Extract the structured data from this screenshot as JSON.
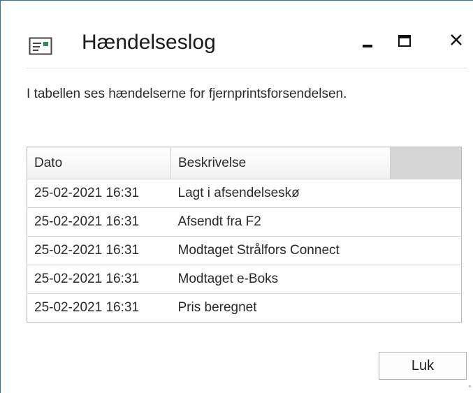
{
  "window": {
    "title": "Hændelseslog",
    "controls": {
      "minimize": "minimize-icon",
      "maximize": "maximize-icon",
      "close": "close-icon"
    }
  },
  "description": "I tabellen ses hændelserne for fjernprintsforsendelsen.",
  "table": {
    "columns": [
      "Dato",
      "Beskrivelse"
    ],
    "rows": [
      {
        "date": "25-02-2021 16:31",
        "description": "Lagt i afsendelseskø"
      },
      {
        "date": "25-02-2021 16:31",
        "description": "Afsendt fra F2"
      },
      {
        "date": "25-02-2021 16:31",
        "description": "Modtaget Strålfors Connect"
      },
      {
        "date": "25-02-2021 16:31",
        "description": "Modtaget e-Boks"
      },
      {
        "date": "25-02-2021 16:31",
        "description": "Pris beregnet"
      }
    ]
  },
  "buttons": {
    "close_label": "Luk"
  },
  "colors": {
    "accent": "#2b6cc4",
    "icon_green": "#2e8b57",
    "header_filler": "#d6d6d6"
  }
}
